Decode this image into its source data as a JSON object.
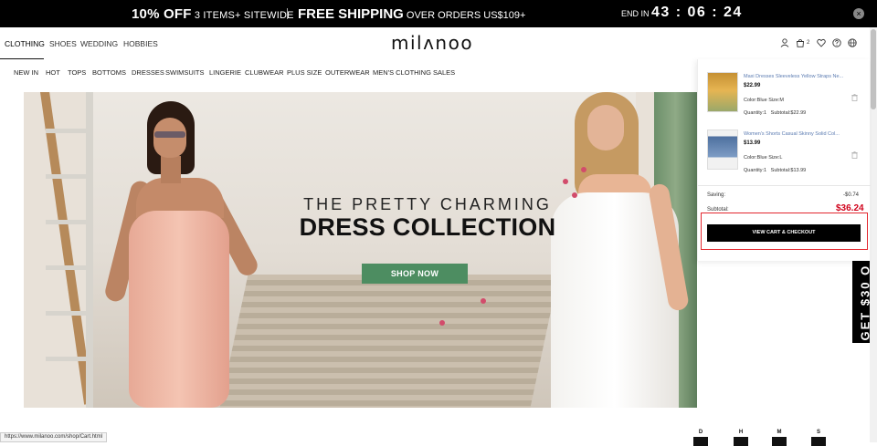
{
  "promo_bar": {
    "offer_strong": "10% OFF",
    "offer_sub": " 3 ITEMS+ SITEWIDE",
    "shipping_strong": "FREE SHIPPING",
    "shipping_sub": " OVER ORDERS US$109+",
    "end_label": "END IN",
    "timer": "43 : 06 : 24",
    "close_label": "×"
  },
  "header": {
    "categories": [
      "CLOTHING",
      "SHOES",
      "WEDDING",
      "HOBBIES"
    ],
    "logo": "milʌnoo",
    "cart_count": "2",
    "icons": [
      "user-icon",
      "cart-icon",
      "heart-icon",
      "help-icon",
      "globe-icon"
    ]
  },
  "nav": {
    "items": [
      "NEW IN",
      "HOT",
      "TOPS",
      "BOTTOMS",
      "DRESSES",
      "SWIMSUITS",
      "LINGERIE",
      "CLUBWEAR",
      "PLUS SIZE",
      "OUTERWEAR",
      "MEN'S CLOTHING",
      "SALES"
    ]
  },
  "hero": {
    "line1": "THE PRETTY CHARMING",
    "line2": "DRESS COLLECTION",
    "button": "SHOP NOW"
  },
  "side_promo": {
    "text": "GET $30 O"
  },
  "cart": {
    "items": [
      {
        "name": "Maxi Dresses Sleeveless Yellow Straps Ne...",
        "price": "$22.99",
        "options": "Color:Blue  Size:M",
        "quantity": "Quantity:1",
        "subtotal": "Subtotal:$22.99",
        "thumb_color": "#d9a640"
      },
      {
        "name": "Women's Shorts Casual Skinny Solid Col...",
        "price": "$13.99",
        "options": "Color:Blue  Size:L",
        "quantity": "Quantity:1",
        "subtotal": "Subtotal:$13.99",
        "thumb_color": "#6d89b3"
      }
    ],
    "saving_label": "Saving:",
    "saving_value": "-$0.74",
    "subtotal_label": "Subtotal:",
    "subtotal_value": "$36.24",
    "checkout_button": "VIEW CART & CHECKOUT"
  },
  "status_bar": {
    "url": "https://www.milanoo.com/shop/Cart.html"
  },
  "countdown_labels": [
    "D",
    "H",
    "M",
    "S"
  ],
  "colors": {
    "promo_bg": "#000000",
    "shop_button": "#4d8d61",
    "price_red": "#d0021b",
    "highlight": "#e3262e"
  }
}
